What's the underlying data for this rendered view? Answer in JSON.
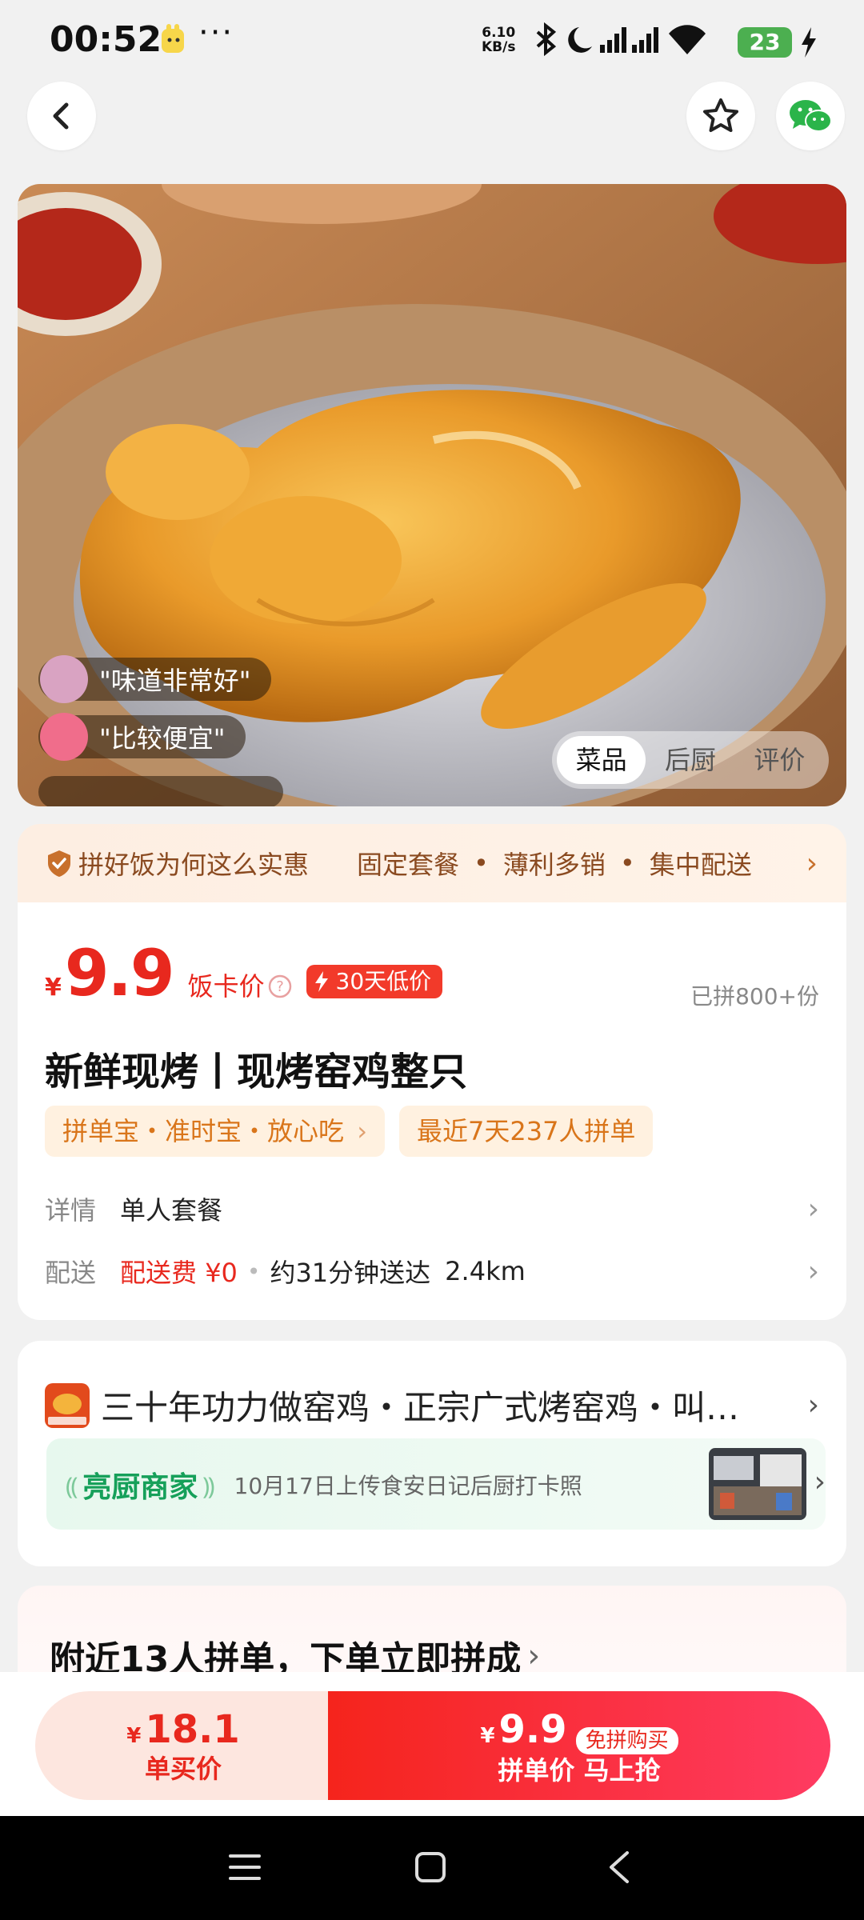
{
  "status_bar": {
    "time": "00:52",
    "more": "···",
    "net_speed": "6.10",
    "net_unit": "KB/s",
    "battery": "23"
  },
  "hero": {
    "comments": [
      "\"味道非常好\"",
      "\"比较便宜\""
    ],
    "tabs": [
      "菜品",
      "后厨",
      "评价"
    ]
  },
  "promo": {
    "label": "拼好饭为何这么实惠",
    "points": [
      "固定套餐",
      "薄利多销",
      "集中配送"
    ],
    "dot": "•",
    "chevron": "›"
  },
  "product": {
    "currency": "¥",
    "price": "9.9",
    "price_label": "饭卡价",
    "low_badge": "30天低价",
    "sold": "已拼800+份",
    "title": "新鲜现烤丨现烤窑鸡整只",
    "chip_guarantee": "拼单宝・准时宝・放心吃",
    "chip_recent": "最近7天237人拼单",
    "detail_label": "详情",
    "detail_value": "单人套餐",
    "delivery_label": "配送",
    "delivery_fee": "配送费 ¥0",
    "delivery_time": "约31分钟送达",
    "distance": "2.4km"
  },
  "shop": {
    "name": "三十年功力做窑鸡・正宗广式烤窑鸡・叫…",
    "kitchen_title": "亮厨商家",
    "kitchen_text": "10月17日上传食安日记后厨打卡照"
  },
  "group": {
    "title": "附近13人拼单，下单立即拼成"
  },
  "actions": {
    "single_currency": "¥",
    "single_price": "18.1",
    "single_label": "单买价",
    "group_currency": "¥",
    "group_price": "9.9",
    "group_tag": "免拼购买",
    "group_label": "拼单价 马上抢"
  },
  "colors": {
    "accent_red": "#e8281e",
    "orange_chip": "#d9751a",
    "green": "#16a05a"
  },
  "icons": [
    "back-icon",
    "star-icon",
    "wechat-icon",
    "shield-icon",
    "help-icon",
    "lightning-icon",
    "menu-icon",
    "home-icon",
    "nav-back-icon"
  ]
}
